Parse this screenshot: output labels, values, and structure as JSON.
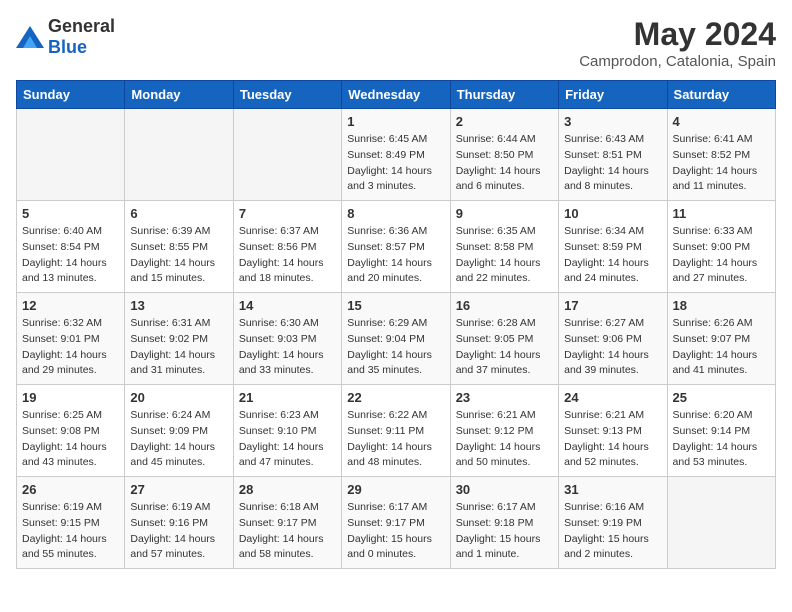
{
  "header": {
    "logo_general": "General",
    "logo_blue": "Blue",
    "month_year": "May 2024",
    "location": "Camprodon, Catalonia, Spain"
  },
  "days_of_week": [
    "Sunday",
    "Monday",
    "Tuesday",
    "Wednesday",
    "Thursday",
    "Friday",
    "Saturday"
  ],
  "weeks": [
    [
      {
        "day": null,
        "info": []
      },
      {
        "day": null,
        "info": []
      },
      {
        "day": null,
        "info": []
      },
      {
        "day": "1",
        "info": [
          "Sunrise: 6:45 AM",
          "Sunset: 8:49 PM",
          "Daylight: 14 hours",
          "and 3 minutes."
        ]
      },
      {
        "day": "2",
        "info": [
          "Sunrise: 6:44 AM",
          "Sunset: 8:50 PM",
          "Daylight: 14 hours",
          "and 6 minutes."
        ]
      },
      {
        "day": "3",
        "info": [
          "Sunrise: 6:43 AM",
          "Sunset: 8:51 PM",
          "Daylight: 14 hours",
          "and 8 minutes."
        ]
      },
      {
        "day": "4",
        "info": [
          "Sunrise: 6:41 AM",
          "Sunset: 8:52 PM",
          "Daylight: 14 hours",
          "and 11 minutes."
        ]
      }
    ],
    [
      {
        "day": "5",
        "info": [
          "Sunrise: 6:40 AM",
          "Sunset: 8:54 PM",
          "Daylight: 14 hours",
          "and 13 minutes."
        ]
      },
      {
        "day": "6",
        "info": [
          "Sunrise: 6:39 AM",
          "Sunset: 8:55 PM",
          "Daylight: 14 hours",
          "and 15 minutes."
        ]
      },
      {
        "day": "7",
        "info": [
          "Sunrise: 6:37 AM",
          "Sunset: 8:56 PM",
          "Daylight: 14 hours",
          "and 18 minutes."
        ]
      },
      {
        "day": "8",
        "info": [
          "Sunrise: 6:36 AM",
          "Sunset: 8:57 PM",
          "Daylight: 14 hours",
          "and 20 minutes."
        ]
      },
      {
        "day": "9",
        "info": [
          "Sunrise: 6:35 AM",
          "Sunset: 8:58 PM",
          "Daylight: 14 hours",
          "and 22 minutes."
        ]
      },
      {
        "day": "10",
        "info": [
          "Sunrise: 6:34 AM",
          "Sunset: 8:59 PM",
          "Daylight: 14 hours",
          "and 24 minutes."
        ]
      },
      {
        "day": "11",
        "info": [
          "Sunrise: 6:33 AM",
          "Sunset: 9:00 PM",
          "Daylight: 14 hours",
          "and 27 minutes."
        ]
      }
    ],
    [
      {
        "day": "12",
        "info": [
          "Sunrise: 6:32 AM",
          "Sunset: 9:01 PM",
          "Daylight: 14 hours",
          "and 29 minutes."
        ]
      },
      {
        "day": "13",
        "info": [
          "Sunrise: 6:31 AM",
          "Sunset: 9:02 PM",
          "Daylight: 14 hours",
          "and 31 minutes."
        ]
      },
      {
        "day": "14",
        "info": [
          "Sunrise: 6:30 AM",
          "Sunset: 9:03 PM",
          "Daylight: 14 hours",
          "and 33 minutes."
        ]
      },
      {
        "day": "15",
        "info": [
          "Sunrise: 6:29 AM",
          "Sunset: 9:04 PM",
          "Daylight: 14 hours",
          "and 35 minutes."
        ]
      },
      {
        "day": "16",
        "info": [
          "Sunrise: 6:28 AM",
          "Sunset: 9:05 PM",
          "Daylight: 14 hours",
          "and 37 minutes."
        ]
      },
      {
        "day": "17",
        "info": [
          "Sunrise: 6:27 AM",
          "Sunset: 9:06 PM",
          "Daylight: 14 hours",
          "and 39 minutes."
        ]
      },
      {
        "day": "18",
        "info": [
          "Sunrise: 6:26 AM",
          "Sunset: 9:07 PM",
          "Daylight: 14 hours",
          "and 41 minutes."
        ]
      }
    ],
    [
      {
        "day": "19",
        "info": [
          "Sunrise: 6:25 AM",
          "Sunset: 9:08 PM",
          "Daylight: 14 hours",
          "and 43 minutes."
        ]
      },
      {
        "day": "20",
        "info": [
          "Sunrise: 6:24 AM",
          "Sunset: 9:09 PM",
          "Daylight: 14 hours",
          "and 45 minutes."
        ]
      },
      {
        "day": "21",
        "info": [
          "Sunrise: 6:23 AM",
          "Sunset: 9:10 PM",
          "Daylight: 14 hours",
          "and 47 minutes."
        ]
      },
      {
        "day": "22",
        "info": [
          "Sunrise: 6:22 AM",
          "Sunset: 9:11 PM",
          "Daylight: 14 hours",
          "and 48 minutes."
        ]
      },
      {
        "day": "23",
        "info": [
          "Sunrise: 6:21 AM",
          "Sunset: 9:12 PM",
          "Daylight: 14 hours",
          "and 50 minutes."
        ]
      },
      {
        "day": "24",
        "info": [
          "Sunrise: 6:21 AM",
          "Sunset: 9:13 PM",
          "Daylight: 14 hours",
          "and 52 minutes."
        ]
      },
      {
        "day": "25",
        "info": [
          "Sunrise: 6:20 AM",
          "Sunset: 9:14 PM",
          "Daylight: 14 hours",
          "and 53 minutes."
        ]
      }
    ],
    [
      {
        "day": "26",
        "info": [
          "Sunrise: 6:19 AM",
          "Sunset: 9:15 PM",
          "Daylight: 14 hours",
          "and 55 minutes."
        ]
      },
      {
        "day": "27",
        "info": [
          "Sunrise: 6:19 AM",
          "Sunset: 9:16 PM",
          "Daylight: 14 hours",
          "and 57 minutes."
        ]
      },
      {
        "day": "28",
        "info": [
          "Sunrise: 6:18 AM",
          "Sunset: 9:17 PM",
          "Daylight: 14 hours",
          "and 58 minutes."
        ]
      },
      {
        "day": "29",
        "info": [
          "Sunrise: 6:17 AM",
          "Sunset: 9:17 PM",
          "Daylight: 15 hours",
          "and 0 minutes."
        ]
      },
      {
        "day": "30",
        "info": [
          "Sunrise: 6:17 AM",
          "Sunset: 9:18 PM",
          "Daylight: 15 hours",
          "and 1 minute."
        ]
      },
      {
        "day": "31",
        "info": [
          "Sunrise: 6:16 AM",
          "Sunset: 9:19 PM",
          "Daylight: 15 hours",
          "and 2 minutes."
        ]
      },
      {
        "day": null,
        "info": []
      }
    ]
  ]
}
